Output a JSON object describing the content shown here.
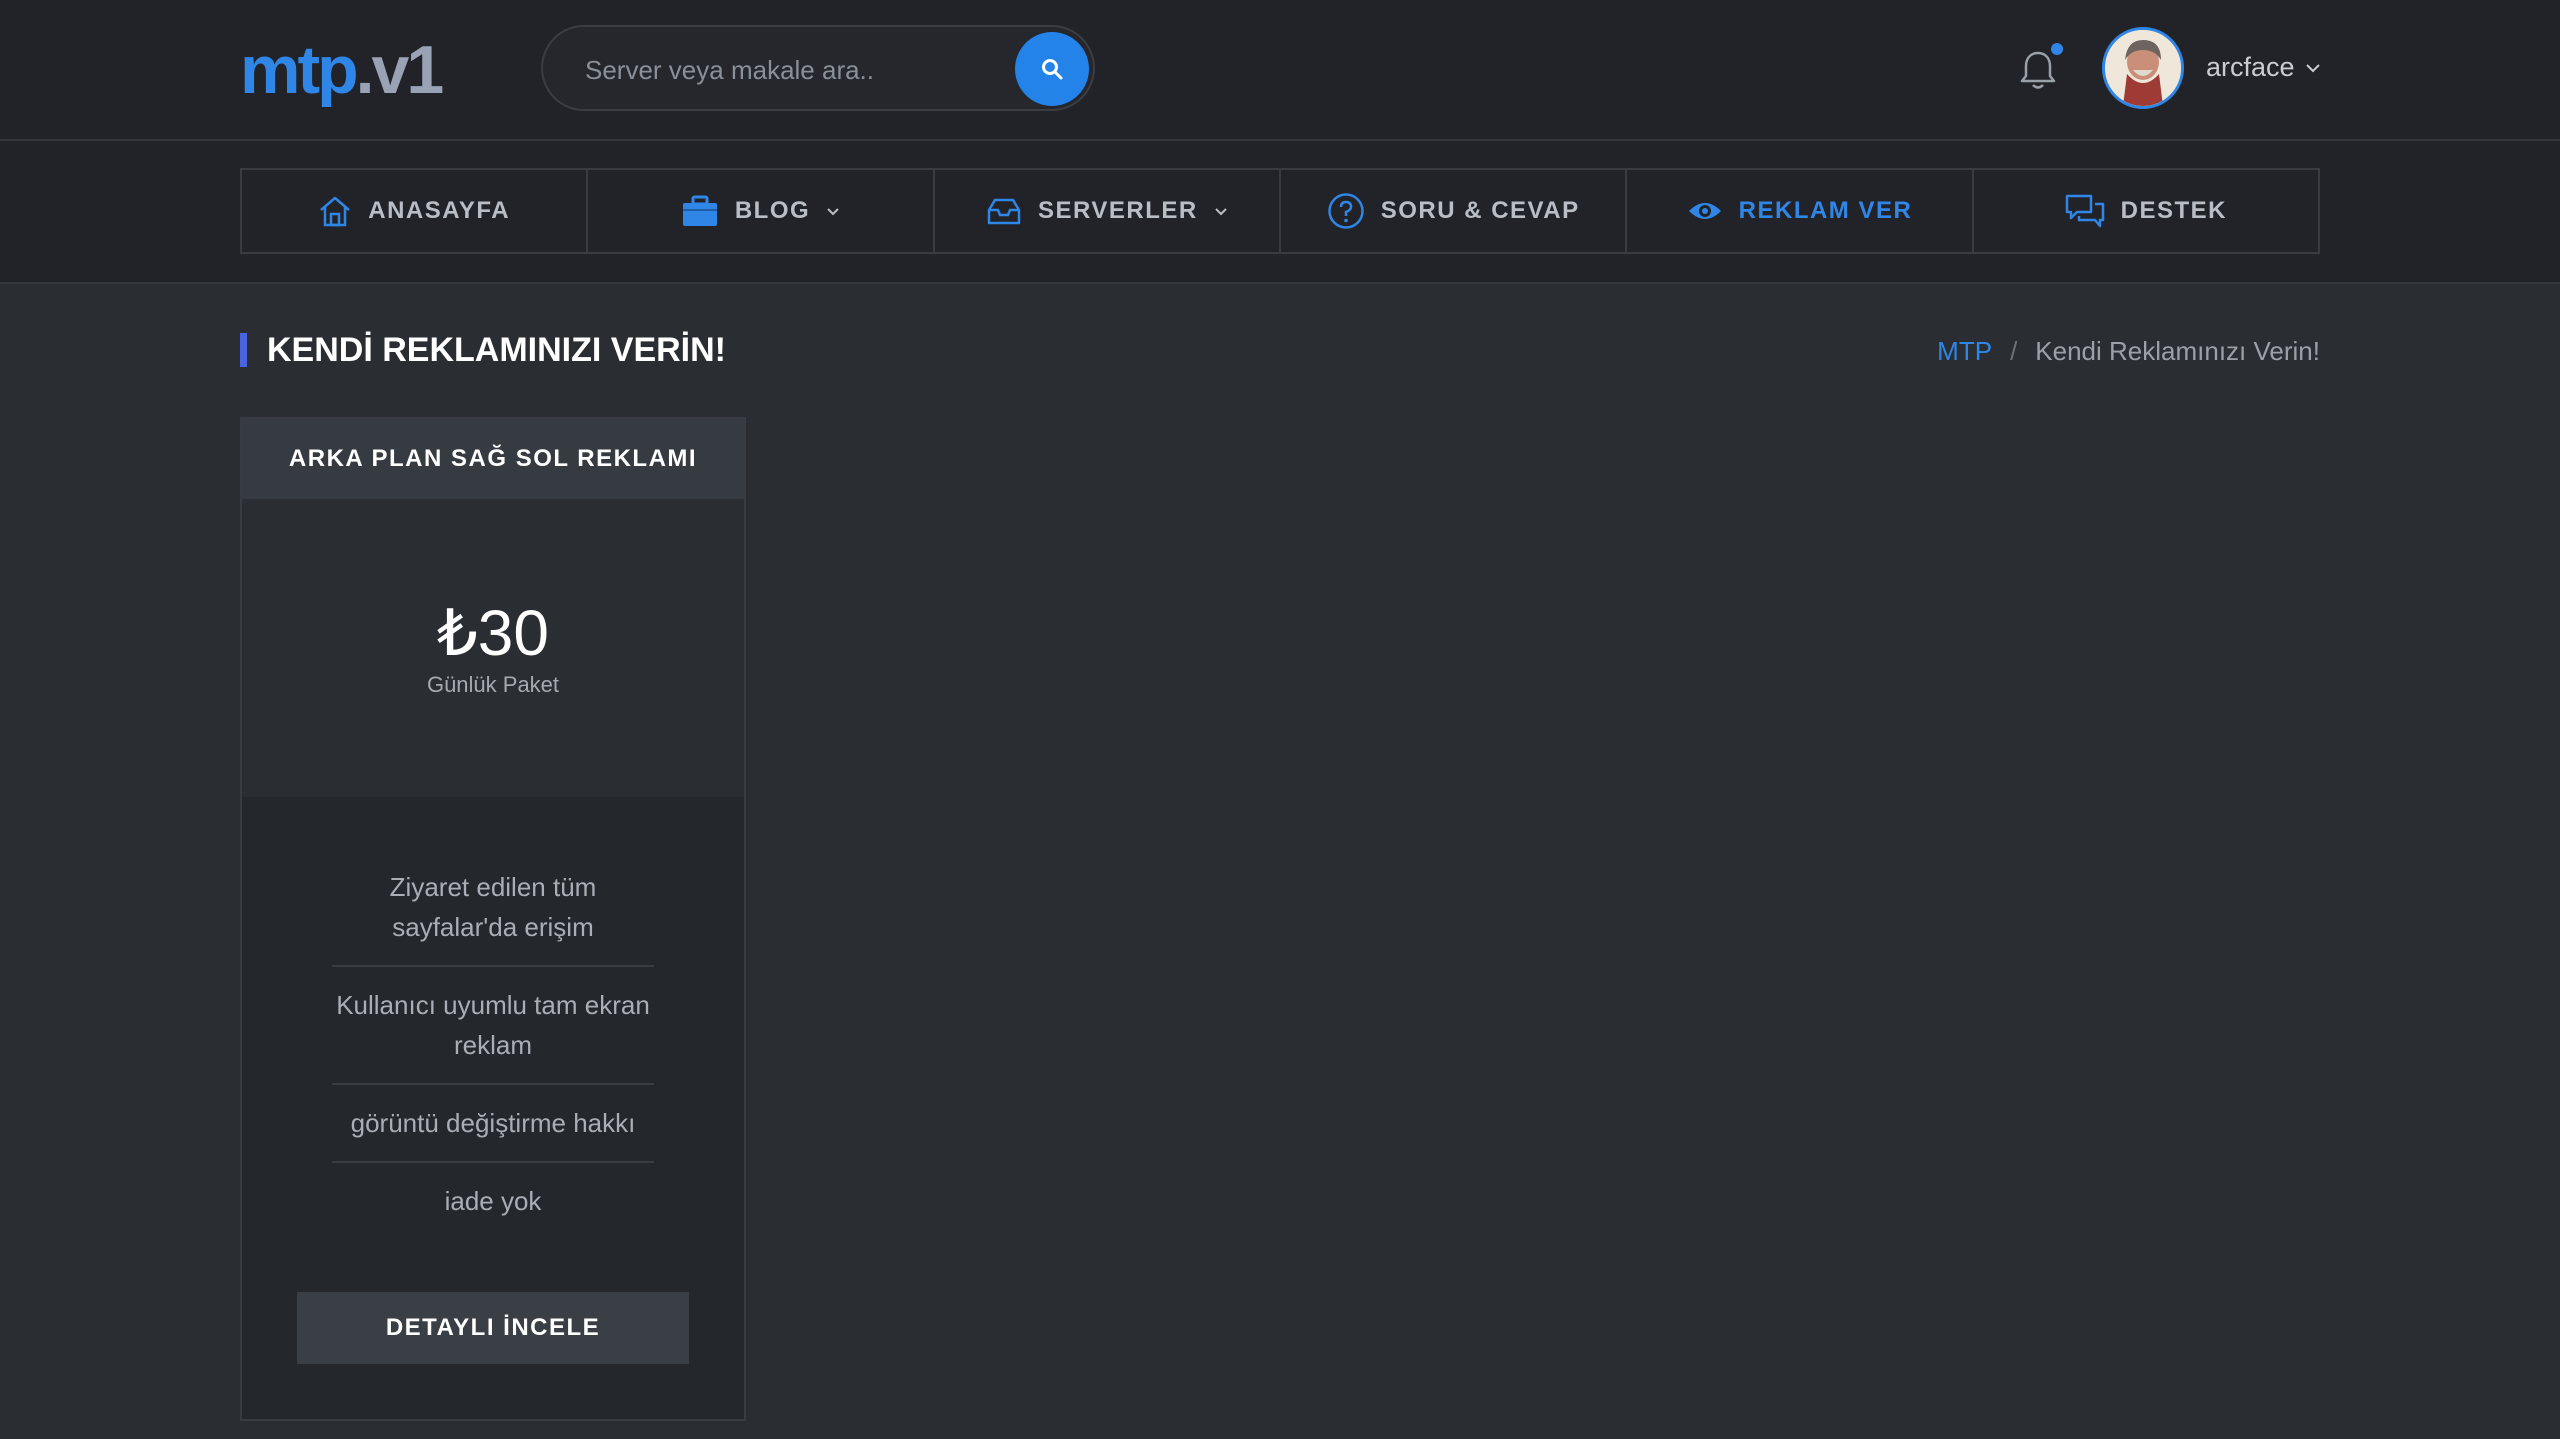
{
  "header": {
    "logo_main": "mtp",
    "logo_suffix": ".v1",
    "search_placeholder": "Server veya makale ara..",
    "username": "arcface"
  },
  "nav": {
    "items": [
      {
        "label": "ANASAYFA",
        "icon": "home-icon"
      },
      {
        "label": "BLOG",
        "icon": "briefcase-icon",
        "dropdown": true
      },
      {
        "label": "SERVERLER",
        "icon": "inbox-icon",
        "dropdown": true
      },
      {
        "label": "SORU & CEVAP",
        "icon": "question-circle-icon"
      },
      {
        "label": "REKLAM VER",
        "icon": "eye-icon",
        "active": true
      },
      {
        "label": "DESTEK",
        "icon": "chat-icon"
      }
    ]
  },
  "page": {
    "title": "KENDİ REKLAMINIZI VERİN!",
    "breadcrumb": {
      "root": "MTP",
      "separator": "/",
      "current": "Kendi Reklamınızı Verin!"
    }
  },
  "card": {
    "title": "ARKA PLAN SAĞ SOL REKLAMI",
    "price": "₺30",
    "price_sub": "Günlük Paket",
    "features": [
      "Ziyaret edilen tüm sayfalar'da erişim",
      "Kullanıcı uyumlu tam ekran reklam",
      "görüntü değiştirme hakkı",
      "iade yok"
    ],
    "button": "DETAYLI İNCELE"
  },
  "colors": {
    "accent": "#2f86e6",
    "background": "#2a2d32",
    "header_bg": "#212328",
    "title_bar": "#4a63e0"
  }
}
